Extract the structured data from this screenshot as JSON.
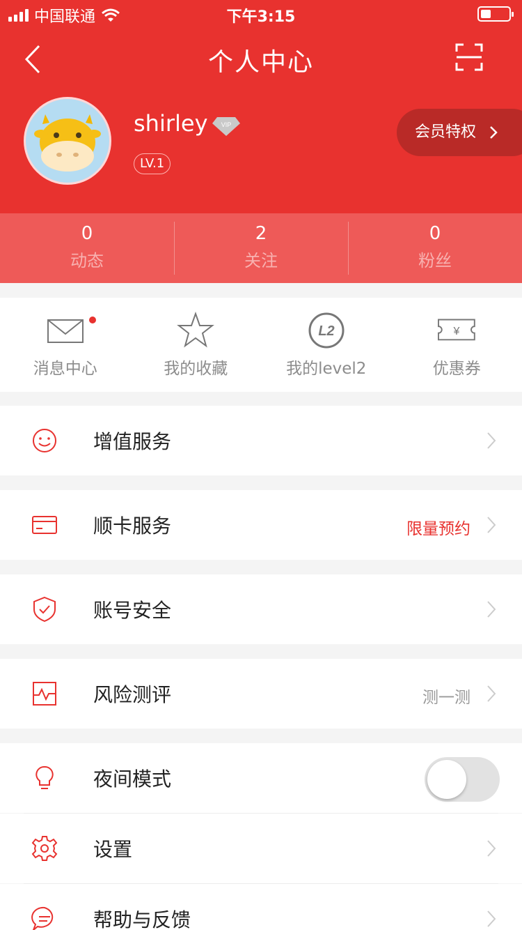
{
  "status_bar": {
    "carrier": "中国联通",
    "time": "下午3:15"
  },
  "nav": {
    "title": "个人中心"
  },
  "profile": {
    "username": "shirley",
    "vip_badge": "VIP",
    "level": "LV.1",
    "member_button": "会员特权"
  },
  "stats": [
    {
      "value": "0",
      "label": "动态"
    },
    {
      "value": "2",
      "label": "关注"
    },
    {
      "value": "0",
      "label": "粉丝"
    }
  ],
  "tools": [
    {
      "label": "消息中心",
      "icon": "mail-icon",
      "has_dot": true
    },
    {
      "label": "我的收藏",
      "icon": "star-icon"
    },
    {
      "label": "我的level2",
      "icon": "level2-icon",
      "icon_text": "L2"
    },
    {
      "label": "优惠券",
      "icon": "coupon-icon",
      "icon_text": "¥"
    }
  ],
  "menu": [
    {
      "label": "增值服务",
      "icon": "smile-icon",
      "extra": ""
    },
    {
      "label": "顺卡服务",
      "icon": "card-icon",
      "extra": "限量预约"
    },
    {
      "label": "账号安全",
      "icon": "shield-icon",
      "extra": ""
    },
    {
      "label": "风险测评",
      "icon": "chart-icon",
      "extra": "测一测"
    },
    {
      "label": "夜间模式",
      "icon": "bulb-icon",
      "toggle_on": false
    },
    {
      "label": "设置",
      "icon": "gear-icon"
    },
    {
      "label": "帮助与反馈",
      "icon": "chat-icon"
    }
  ],
  "colors": {
    "brand_red": "#e8322f",
    "stats_bg": "#ee5a58",
    "page_bg": "#f4f4f4"
  }
}
